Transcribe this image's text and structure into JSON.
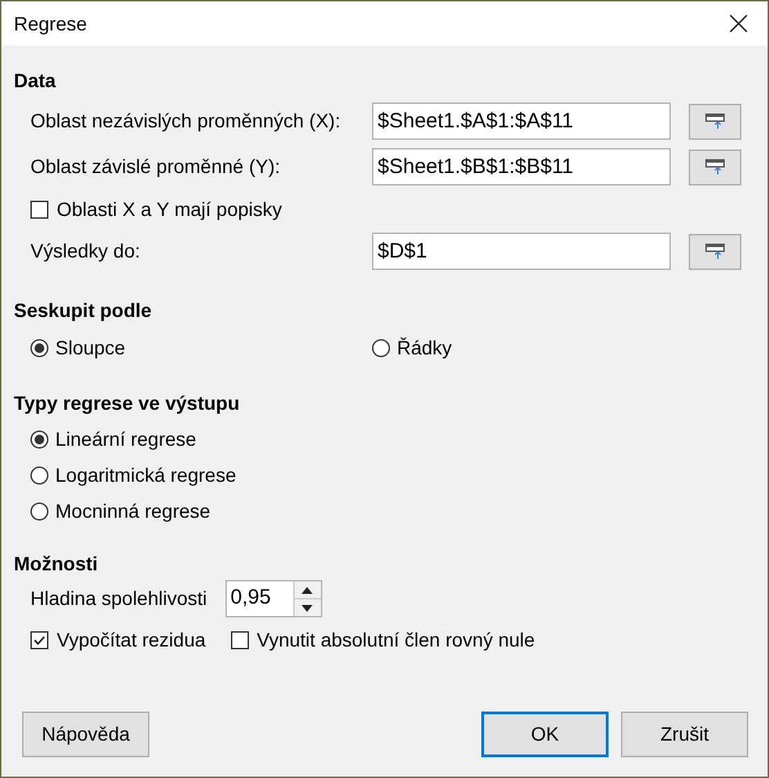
{
  "window": {
    "title": "Regrese"
  },
  "data": {
    "heading": "Data",
    "fields": [
      {
        "label": "Oblast nezávislých proměnných (X):",
        "value": "$Sheet1.$A$1:$A$11"
      },
      {
        "label": "Oblast závislé proměnné (Y):",
        "value": "$Sheet1.$B$1:$B$11"
      }
    ],
    "labels_checkbox": {
      "label": "Oblasti X a Y mají popisky",
      "checked": false
    },
    "output": {
      "label": "Výsledky do:",
      "value": "$D$1"
    }
  },
  "group_by": {
    "heading": "Seskupit podle",
    "options": [
      {
        "label": "Sloupce",
        "selected": true
      },
      {
        "label": "Řádky",
        "selected": false
      }
    ]
  },
  "regression_types": {
    "heading": "Typy regrese ve výstupu",
    "options": [
      {
        "label": "Lineární regrese",
        "selected": true
      },
      {
        "label": "Logaritmická regrese",
        "selected": false
      },
      {
        "label": "Mocninná regrese",
        "selected": false
      }
    ]
  },
  "options": {
    "heading": "Možnosti",
    "confidence": {
      "label": "Hladina spolehlivosti",
      "value": "0,95"
    },
    "checkboxes": [
      {
        "label": "Vypočítat rezidua",
        "checked": true
      },
      {
        "label": "Vynutit absolutní člen rovný nule",
        "checked": false
      }
    ]
  },
  "buttons": [
    {
      "label": "Nápověda",
      "default": false
    },
    {
      "label": "OK",
      "default": true
    },
    {
      "label": "Zrušit",
      "default": false
    }
  ]
}
